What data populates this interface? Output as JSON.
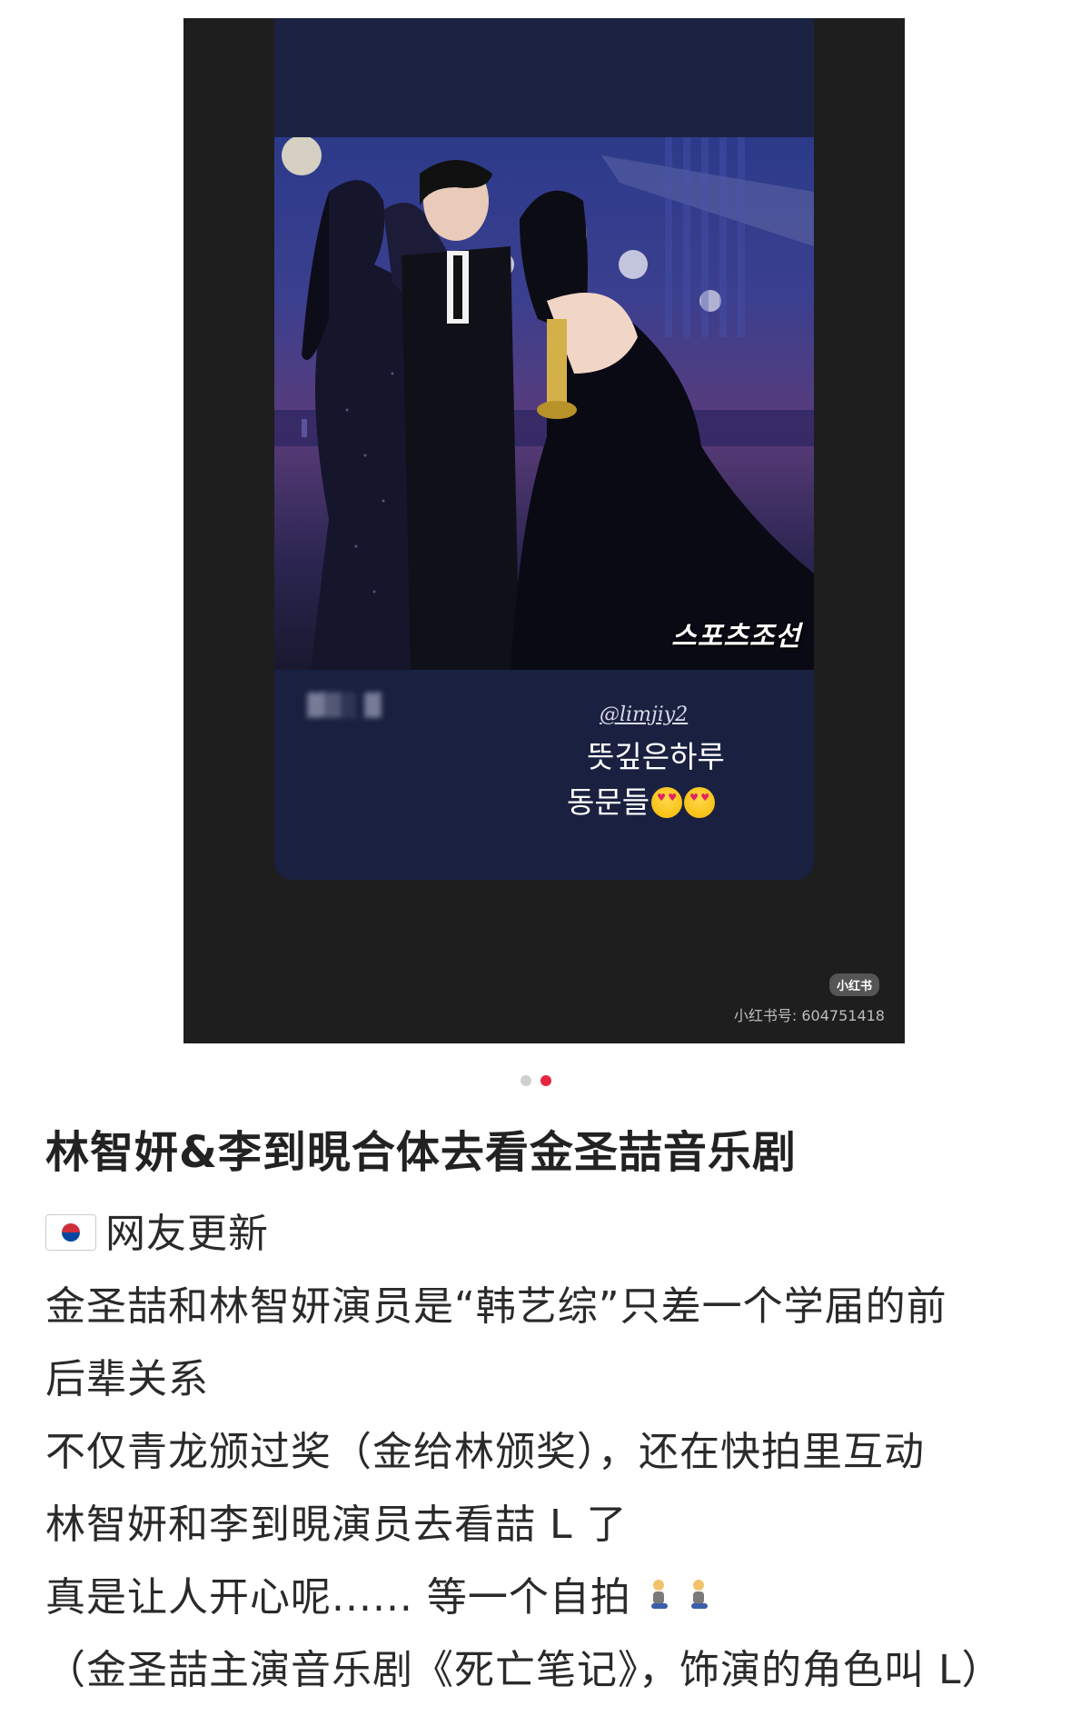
{
  "story": {
    "photo_watermark": "스포츠조선",
    "caption_handle": "@limjiy2",
    "caption_line1": "뜻깊은하루",
    "caption_line2": "동문들",
    "xhs_badge": "小红书",
    "xhs_id": "小红书号: 604751418"
  },
  "pagination": {
    "count": 2,
    "active_index": 1
  },
  "post": {
    "title": "林智妍&李到晛合体去看金圣喆音乐剧",
    "lines": [
      "网友更新",
      "金圣喆和林智妍演员是“韩艺综”只差一个学届的前",
      "后辈关系",
      "不仅青龙颁过奖（金给林颁奖），还在快拍里互动",
      "林智妍和李到晛演员去看喆 L 了",
      "真是让人开心呢...... 等一个自拍",
      "（金圣喆主演音乐剧《死亡笔记》，饰演的角色叫 L）"
    ]
  },
  "colors": {
    "accent": "#e5263e",
    "story_bg": "#1a2140",
    "frame_bg": "#1e1e1e"
  }
}
